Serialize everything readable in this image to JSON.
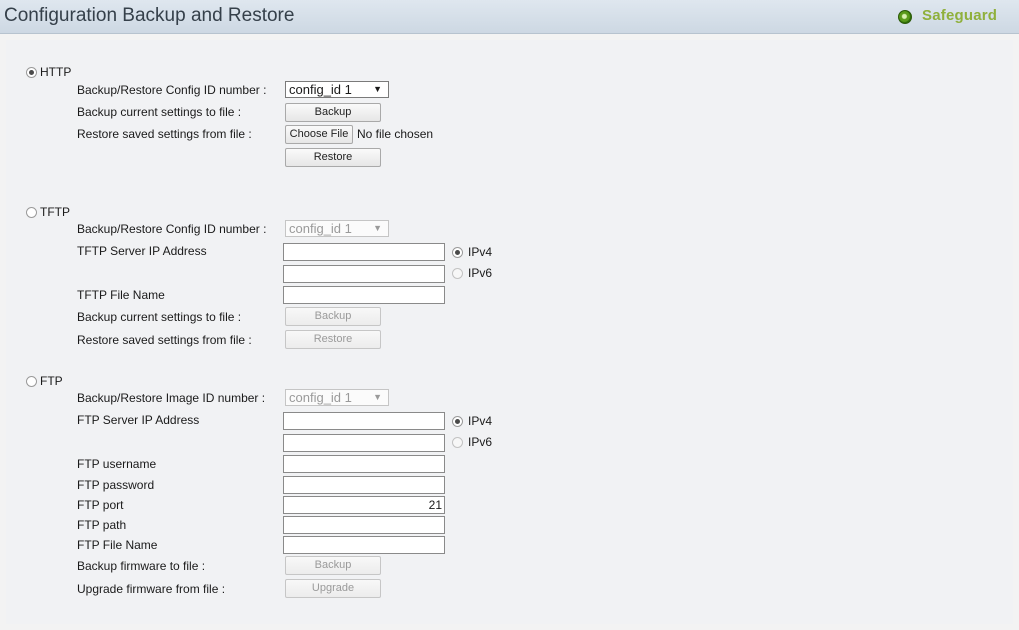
{
  "header": {
    "title": "Configuration Backup and Restore",
    "safeguard_label": "Safeguard"
  },
  "http": {
    "label": "HTTP",
    "selected": true,
    "config_id_label": "Backup/Restore Config ID number :",
    "config_id_value": "config_id 1",
    "backup_label": "Backup current settings to file :",
    "backup_button": "Backup",
    "restore_label": "Restore saved settings from file :",
    "choose_file_button": "Choose File",
    "no_file_text": "No file chosen",
    "restore_button": "Restore"
  },
  "tftp": {
    "label": "TFTP",
    "selected": false,
    "config_id_label": "Backup/Restore Config ID number :",
    "config_id_value": "config_id 1",
    "server_ip_label": "TFTP Server IP Address",
    "ipv4_label": "IPv4",
    "ipv6_label": "IPv6",
    "file_name_label": "TFTP File Name",
    "backup_label": "Backup current settings to file :",
    "backup_button": "Backup",
    "restore_label": "Restore saved settings from file :",
    "restore_button": "Restore"
  },
  "ftp": {
    "label": "FTP",
    "selected": false,
    "image_id_label": "Backup/Restore Image ID number :",
    "image_id_value": "config_id 1",
    "server_ip_label": "FTP Server IP Address",
    "ipv4_label": "IPv4",
    "ipv6_label": "IPv6",
    "username_label": "FTP username",
    "password_label": "FTP password",
    "port_label": "FTP port",
    "port_value": "21",
    "path_label": "FTP path",
    "file_name_label": "FTP File Name",
    "backup_label": "Backup firmware to file :",
    "backup_button": "Backup",
    "upgrade_label": "Upgrade firmware from file :",
    "upgrade_button": "Upgrade"
  },
  "colors": {
    "title_bar": "#d6dfe8",
    "safeguard_green": "#8fb03c",
    "background": "#f1f2f4"
  }
}
